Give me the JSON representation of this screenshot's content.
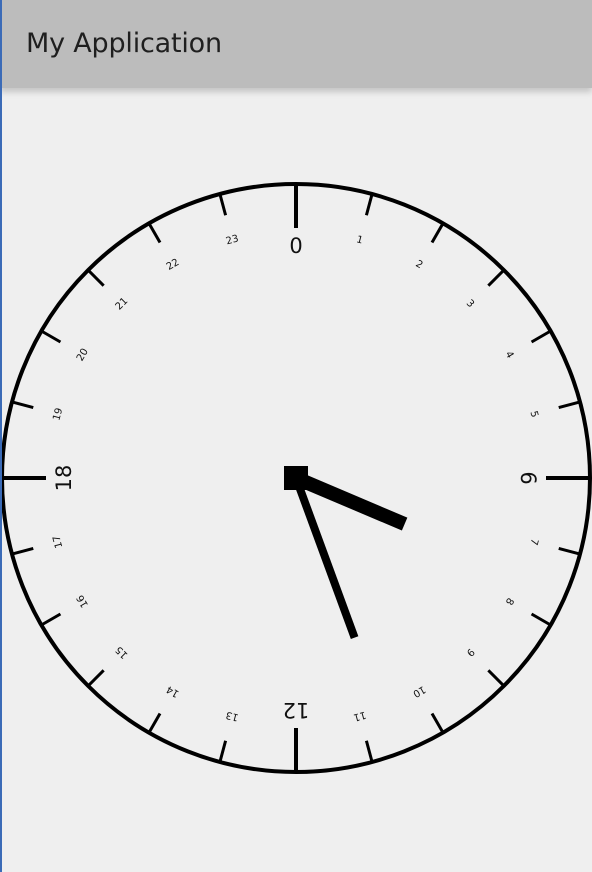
{
  "app_bar": {
    "title": "My Application"
  },
  "clock": {
    "type": "24-hour analog clock",
    "orientation": "hour 0 at top, increasing clockwise",
    "hour_labels": [
      "0",
      "1",
      "2",
      "3",
      "4",
      "5",
      "6",
      "7",
      "8",
      "9",
      "10",
      "11",
      "12",
      "13",
      "14",
      "15",
      "16",
      "17",
      "18",
      "19",
      "20",
      "21",
      "22",
      "23"
    ],
    "major_labels": [
      "0",
      "6",
      "12",
      "18"
    ],
    "hour_hand_position_hours": 7.0,
    "minute_hand_position_fraction": 0.444,
    "colors": {
      "face_stroke": "#000000",
      "hands": "#000000",
      "background": "#efefef",
      "app_bar": "#bcbcbc"
    }
  }
}
